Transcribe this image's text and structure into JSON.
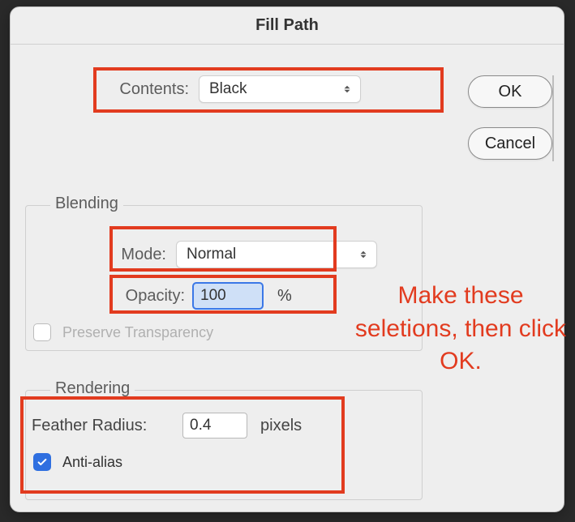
{
  "title": "Fill Path",
  "buttons": {
    "ok": "OK",
    "cancel": "Cancel"
  },
  "contents": {
    "label": "Contents:",
    "value": "Black"
  },
  "blending": {
    "legend": "Blending",
    "mode_label": "Mode:",
    "mode_value": "Normal",
    "opacity_label": "Opacity:",
    "opacity_value": "100",
    "opacity_unit": "%",
    "preserve_label": "Preserve Transparency",
    "preserve_checked": false
  },
  "rendering": {
    "legend": "Rendering",
    "feather_label": "Feather Radius:",
    "feather_value": "0.4",
    "feather_unit": "pixels",
    "antialias_label": "Anti-alias",
    "antialias_checked": true
  },
  "annotation": "Make these seletions, then click OK.",
  "highlight_color": "#e23b1f"
}
